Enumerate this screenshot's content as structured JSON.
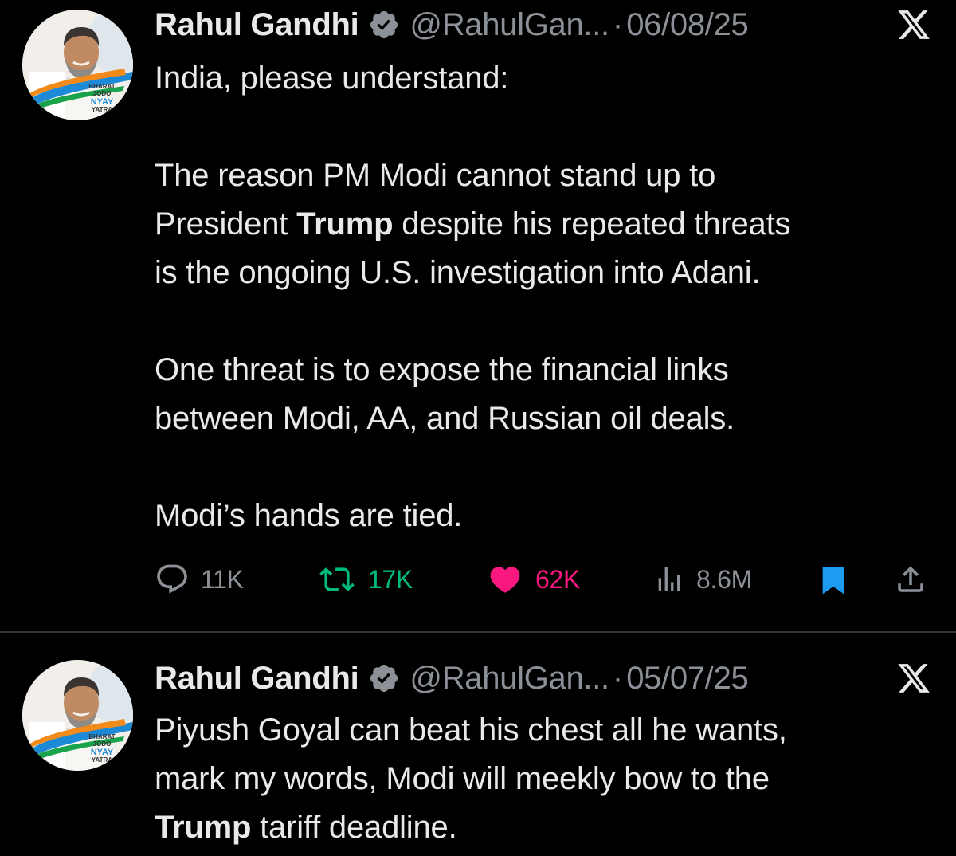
{
  "tweets": [
    {
      "author": {
        "name": "Rahul Gandhi",
        "handle": "@RahulGan...",
        "verified": true,
        "avatar_badge_lines": [
          "BHARAT",
          "JODO",
          "NYAY",
          "YATRA"
        ]
      },
      "separator": "·",
      "date": "06/08/25",
      "platform_icon": "x-logo-icon",
      "body": {
        "p1": "India, please understand:",
        "p2_l1": "The reason PM Modi cannot stand up to",
        "p2_l2_pre": "President ",
        "p2_l2_bold": "Trump",
        "p2_l2_post": " despite his repeated threats",
        "p2_l3": "is the ongoing U.S. investigation into Adani.",
        "p3_l1": "One threat is to expose the financial links",
        "p3_l2": "between Modi, AA, and Russian oil deals.",
        "p4": "Modi’s hands are tied."
      },
      "metrics": {
        "replies": "11K",
        "reposts": "17K",
        "likes": "62K",
        "views": "8.6M",
        "liked": true,
        "bookmarked": true
      }
    },
    {
      "author": {
        "name": "Rahul Gandhi",
        "handle": "@RahulGan...",
        "verified": true,
        "avatar_badge_lines": [
          "BHARAT",
          "JODO",
          "NYAY",
          "YATRA"
        ]
      },
      "separator": "·",
      "date": "05/07/25",
      "platform_icon": "x-logo-icon",
      "body": {
        "l1": "Piyush Goyal can beat his chest all he wants,",
        "l2": "mark my words, Modi will meekly bow to the",
        "l3_bold": "Trump",
        "l3_post": " tariff deadline."
      }
    }
  ],
  "colors": {
    "background": "#000000",
    "text": "#e7e9ea",
    "secondary_text": "#8b9197",
    "verified_badge": "#8b9197",
    "repost": "#00ba7c",
    "like": "#f91880",
    "bookmark": "#1d9bf0",
    "divider": "#2f3336"
  }
}
